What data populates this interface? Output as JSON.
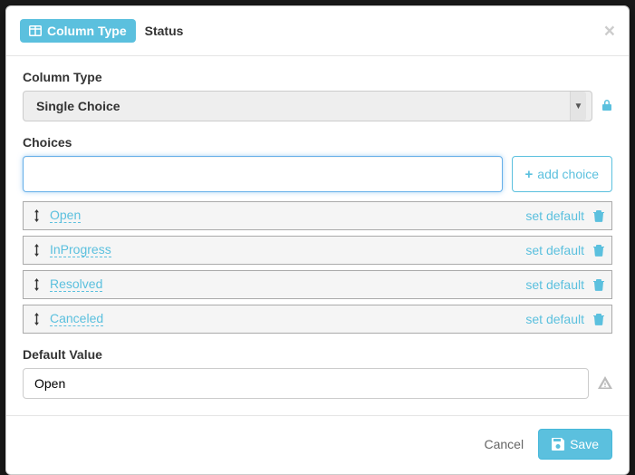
{
  "header": {
    "chip_label": "Column Type",
    "column_name": "Status"
  },
  "body": {
    "column_type_label": "Column Type",
    "column_type_value": "Single Choice",
    "choices_label": "Choices",
    "new_choice_value": "",
    "add_choice_label": "add choice",
    "set_default_label": "set default",
    "choices": [
      {
        "name": "Open"
      },
      {
        "name": "InProgress"
      },
      {
        "name": "Resolved"
      },
      {
        "name": "Canceled"
      }
    ],
    "default_value_label": "Default Value",
    "default_value": "Open"
  },
  "footer": {
    "cancel_label": "Cancel",
    "save_label": "Save"
  },
  "colors": {
    "accent": "#5bc0de"
  }
}
